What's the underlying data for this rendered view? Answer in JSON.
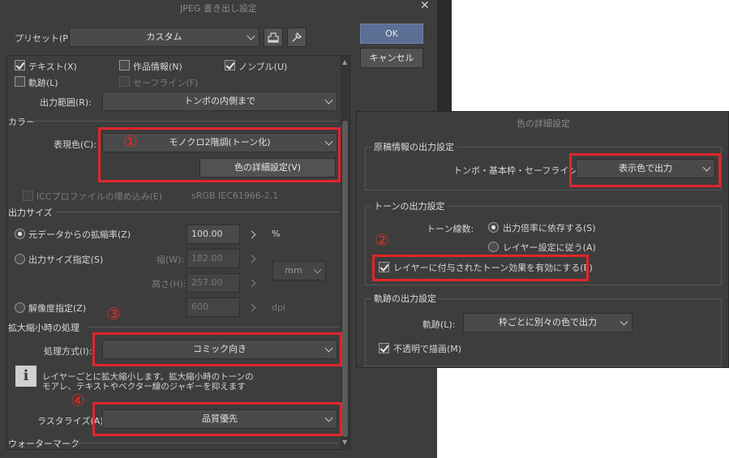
{
  "main": {
    "title": "JPEG 書き出し設定",
    "preset_label": "プリセット(P):",
    "preset_value": "カスタム",
    "ok": "OK",
    "cancel": "キャンセル",
    "cb_text": "テキスト(X)",
    "cb_work_info": "作品情報(N)",
    "cb_nombre": "ノンブル(U)",
    "cb_trace": "軌跡(L)",
    "cb_safe_line": "セーフライン(F)",
    "output_range_label": "出力範囲(R):",
    "output_range_value": "トンボの内側まで",
    "color_section": "カラー",
    "expr_color_label": "表現色(C):",
    "expr_color_value": "モノクロ2階調(トーン化)",
    "color_detail_btn": "色の詳細設定(V)",
    "icc_label": "ICCプロファイルの埋め込み(E)",
    "icc_value": "sRGB IEC61966-2.1",
    "size_section": "出力サイズ",
    "scale_label": "元データからの拡縮率(Z)",
    "scale_value": "100.00",
    "scale_unit": "%",
    "size_spec_label": "出力サイズ指定(S)",
    "width_label": "幅(W):",
    "width_value": "182.00",
    "height_label": "高さ(H):",
    "height_value": "257.00",
    "unit_value": "mm",
    "res_label": "解像度指定(Z)",
    "res_value": "600",
    "res_unit": "dpi",
    "scaling_section": "拡大縮小時の処理",
    "method_label": "処理方式(I):",
    "method_value": "コミック向き",
    "info_text_1": "レイヤーごとに拡大縮小します。拡大縮小時のトーンの",
    "info_text_2": "モアレ、テキストやベクター線のジャギーを抑えます",
    "raster_label": "ラスタライズ(A):",
    "raster_value": "品質優先",
    "watermark_section": "ウォーターマーク"
  },
  "detail": {
    "title": "色の詳細設定",
    "manuscript_section": "原稿情報の出力設定",
    "tombo_label": "トンボ・基本枠・セーフライン(T):",
    "tombo_value": "表示色で出力",
    "tone_section": "トーンの出力設定",
    "tone_lines_label": "トーン線数:",
    "tone_opt1": "出力倍率に依存する(S)",
    "tone_opt2": "レイヤー設定に従う(A)",
    "tone_effect_cb": "レイヤーに付与されたトーン効果を有効にする(E)",
    "trace_section": "軌跡の出力設定",
    "trace_label": "軌跡(L):",
    "trace_value": "枠ごとに別々の色で出力",
    "opaque_cb": "不透明で描画(M)"
  },
  "annotations": {
    "n1": "①",
    "n2": "②",
    "n3": "③",
    "n4": "④"
  },
  "colors": {
    "highlight": "#e1262b",
    "dialog_bg": "#3d3d3d",
    "ok_button": "#5a6f93"
  }
}
